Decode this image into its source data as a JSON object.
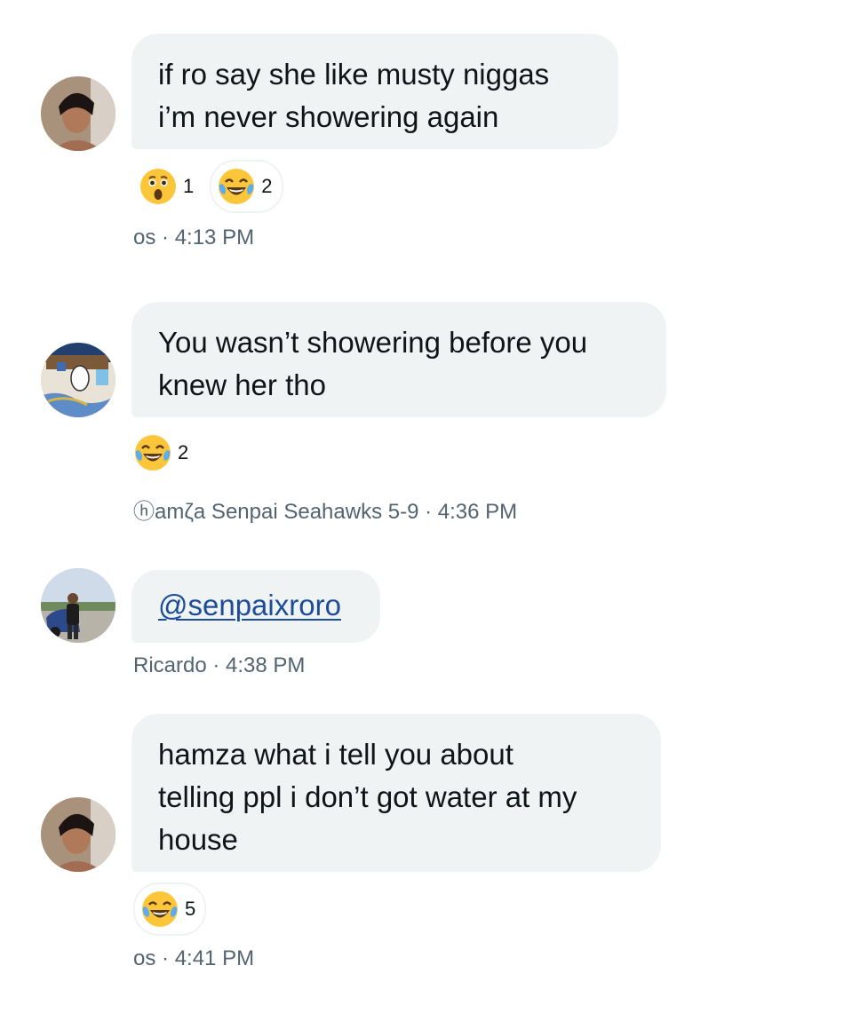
{
  "messages": [
    {
      "lines": [
        "if ro say she like musty niggas",
        "i’m never showering again"
      ],
      "reactions": [
        {
          "icon": "astonished-face-icon",
          "count": "1"
        },
        {
          "icon": "laughing-tears-icon",
          "count": "2"
        }
      ],
      "sender": "os",
      "time": "· 4:13 PM"
    },
    {
      "lines": [
        "You wasn’t showering before you",
        "knew her tho"
      ],
      "reactions": [
        {
          "icon": "laughing-tears-icon",
          "count": "2"
        }
      ],
      "sender": "ⓗamζa Senpai Seahawks 5-9",
      "time": "· 4:36 PM"
    },
    {
      "mention": "@senpaixroro",
      "sender": "Ricardo",
      "time": "· 4:38 PM"
    },
    {
      "lines": [
        "hamza what i tell you about",
        "telling ppl i don’t got water at my",
        "house"
      ],
      "reactions": [
        {
          "icon": "laughing-tears-icon",
          "count": "5"
        }
      ],
      "sender": "os",
      "time": "· 4:41 PM"
    }
  ],
  "colors": {
    "bubble": "#eff3f4",
    "text": "#0f1419",
    "meta": "#536471",
    "mention": "#1d4c99"
  }
}
